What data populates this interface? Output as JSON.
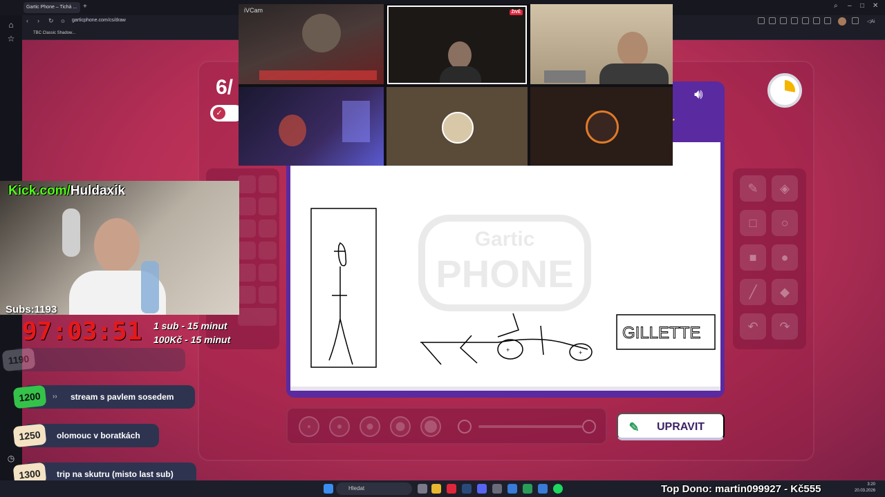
{
  "browser": {
    "tab_title": "Gartic Phone – Tichá ...",
    "url": "garticphone.com/cs/draw",
    "bookmark": "TBC Classic Shadow..."
  },
  "game": {
    "round": "6/",
    "canvas_text": "GILLETTE",
    "watermark_top": "Gartic",
    "watermark_bottom": "PHONE",
    "action_button": "UPRAVIT"
  },
  "stream": {
    "cam_label": "iVCam",
    "live_badge": "ŽIVĚ",
    "kick_prefix": "Kick.com/",
    "kick_name": "Huldaxik",
    "subs": "Subs:1193",
    "countdown": "97:03:51",
    "rates": [
      "1 sub - 15 minut",
      "100Kč - 15 minut"
    ],
    "goals": [
      {
        "num": "1190",
        "text": ""
      },
      {
        "num": "1200",
        "text": "stream s pavlem sosedem"
      },
      {
        "num": "1250",
        "text": "olomouc v boratkách"
      },
      {
        "num": "1300",
        "text": "trip na skutru (misto last sub)"
      }
    ],
    "top_dono": "Top Dono: martin099927 - Kč555"
  },
  "taskbar": {
    "search": "Hledat",
    "time": "3:20",
    "date": "20.03.2026"
  },
  "colors": {
    "page_bg": "#c2345a",
    "canvas_frame": "#5a2aa0",
    "countdown": "#e81818",
    "kick_green": "#53fc18",
    "goal_active": "#35c24a"
  }
}
